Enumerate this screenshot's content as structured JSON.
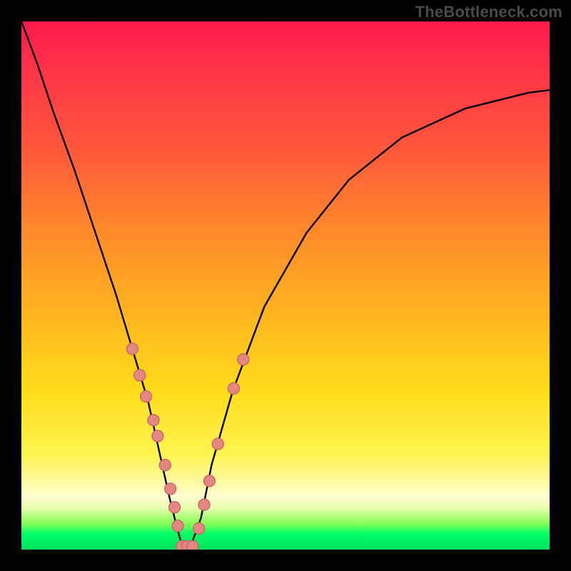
{
  "watermark": "TheBottleneck.com",
  "chart_data": {
    "type": "line",
    "title": "",
    "xlabel": "",
    "ylabel": "",
    "xlim": [
      0,
      100
    ],
    "ylim": [
      0,
      100
    ],
    "series": [
      {
        "name": "bottleneck-curve",
        "x": [
          0,
          3,
          6,
          10,
          14,
          18,
          21,
          24,
          26,
          28,
          29.5,
          30.5,
          32,
          34,
          36,
          40,
          46,
          54,
          62,
          72,
          84,
          96,
          100
        ],
        "y": [
          100,
          92,
          83,
          72,
          60,
          48,
          38,
          28,
          19,
          10,
          4,
          0.5,
          0.5,
          6,
          16,
          30,
          46,
          60,
          70,
          78,
          83.5,
          86.5,
          87
        ]
      }
    ],
    "markers": [
      {
        "name": "left-branch-markers",
        "side": "left",
        "x": [
          21.0,
          22.4,
          23.6,
          25.0,
          25.8,
          27.2,
          28.2,
          29.0,
          29.6
        ],
        "y": [
          38.0,
          33.0,
          29.0,
          24.5,
          21.5,
          16.0,
          11.5,
          8.0,
          4.5
        ]
      },
      {
        "name": "valley-markers",
        "side": "bottom",
        "x": [
          30.4,
          31.4,
          32.4
        ],
        "y": [
          0.6,
          0.6,
          0.6
        ]
      },
      {
        "name": "right-branch-markers",
        "side": "right",
        "x": [
          33.6,
          34.6,
          35.6,
          37.2,
          40.2,
          42.0
        ],
        "y": [
          4.0,
          8.5,
          13.0,
          20.0,
          30.5,
          36.0
        ]
      }
    ],
    "marker_style": {
      "fill": "#e38783",
      "stroke": "#c86b66",
      "r": 8
    },
    "line_style": {
      "stroke": "#000000",
      "width": 2.4
    },
    "description": "V-shaped bottleneck curve over a vertical red-to-green gradient. Minimum near x≈31 where curve touches the green band (y≈0). Left branch rises steeply toward y=100 at x=0; right branch rises asymptotically to y≈87 at x=100. Pink circular markers cluster on both branches in the lower third and along the valley floor."
  }
}
